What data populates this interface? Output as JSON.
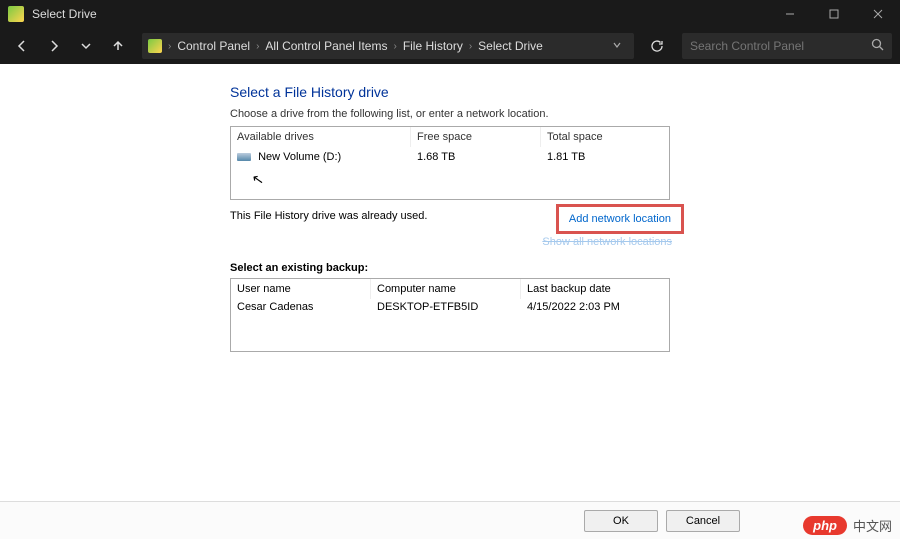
{
  "titlebar": {
    "title": "Select Drive"
  },
  "breadcrumbs": {
    "items": [
      "Control Panel",
      "All Control Panel Items",
      "File History",
      "Select Drive"
    ]
  },
  "search": {
    "placeholder": "Search Control Panel"
  },
  "page": {
    "heading": "Select a File History drive",
    "subtext": "Choose a drive from the following list, or enter a network location.",
    "already_used": "This File History drive was already used.",
    "add_network": "Add network location",
    "show_all": "Show all network locations",
    "existing_label": "Select an existing backup:"
  },
  "drives": {
    "headers": {
      "available": "Available drives",
      "free": "Free space",
      "total": "Total space"
    },
    "rows": [
      {
        "name": "New Volume (D:)",
        "free": "1.68 TB",
        "total": "1.81 TB"
      }
    ]
  },
  "backups": {
    "headers": {
      "user": "User name",
      "computer": "Computer name",
      "date": "Last backup date"
    },
    "rows": [
      {
        "user": "Cesar Cadenas",
        "computer": "DESKTOP-ETFB5ID",
        "date": "4/15/2022 2:03 PM"
      }
    ]
  },
  "buttons": {
    "ok": "OK",
    "cancel": "Cancel"
  },
  "watermark": {
    "badge": "php",
    "text": "中文网"
  }
}
